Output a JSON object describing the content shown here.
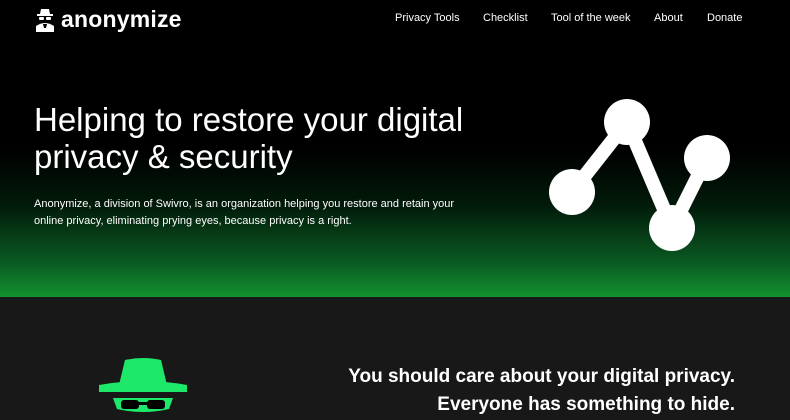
{
  "brand": {
    "name": "anonymize",
    "icon": "spy-logo-icon"
  },
  "nav": {
    "items": [
      {
        "label": "Privacy Tools"
      },
      {
        "label": "Checklist"
      },
      {
        "label": "Tool of the week"
      },
      {
        "label": "About"
      },
      {
        "label": "Donate"
      }
    ]
  },
  "hero": {
    "title_line1": "Helping to restore your digital",
    "title_line2": "privacy & security",
    "description": "Anonymize, a division of Swivro, is an organization helping you restore and retain your online privacy, eliminating prying eyes, because privacy is a right.",
    "graphic_icon": "network-nodes-icon"
  },
  "section2": {
    "icon": "spy-icon",
    "tagline_line1": "You should care about your digital privacy.",
    "tagline_line2": "Everyone has something to hide."
  },
  "colors": {
    "background": "#000000",
    "accent_green": "#13912f",
    "spy_green": "#1ee86a",
    "section_bg": "#181818",
    "text": "#ffffff"
  }
}
